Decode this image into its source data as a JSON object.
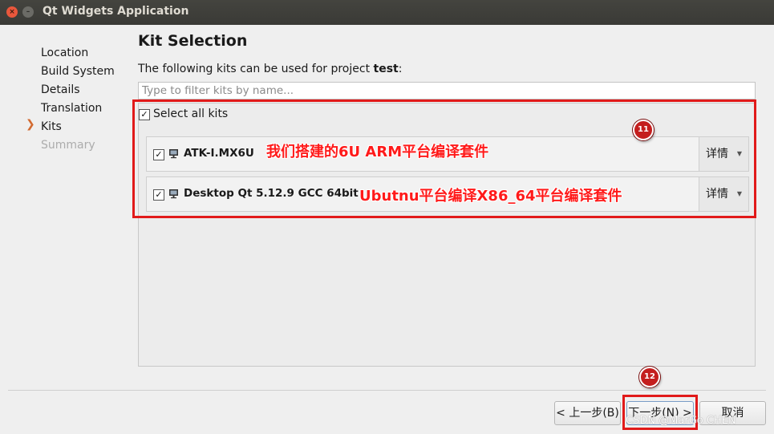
{
  "window": {
    "title": "Qt Widgets Application",
    "close_glyph": "×",
    "minimize_glyph": "–"
  },
  "sidebar": {
    "items": [
      {
        "label": "Location",
        "state": "done"
      },
      {
        "label": "Build System",
        "state": "done"
      },
      {
        "label": "Details",
        "state": "done"
      },
      {
        "label": "Translation",
        "state": "done"
      },
      {
        "label": "Kits",
        "state": "current"
      },
      {
        "label": "Summary",
        "state": "disabled"
      }
    ],
    "current_marker": "❯"
  },
  "main": {
    "title": "Kit Selection",
    "description_prefix": "The following kits can be used for project ",
    "project_name": "test",
    "description_suffix": ":",
    "filter": {
      "value": "",
      "placeholder": "Type to filter kits by name..."
    },
    "select_all": {
      "label": "Select all kits",
      "checked": true,
      "check_glyph": "✓"
    },
    "kits": [
      {
        "name": "ATK-I.MX6U",
        "checked": true,
        "details_label": "详情",
        "icon": "monitor-icon"
      },
      {
        "name": "Desktop Qt 5.12.9 GCC 64bit",
        "checked": true,
        "details_label": "详情",
        "icon": "monitor-icon"
      }
    ],
    "details_caret": "▼"
  },
  "annotations": {
    "kit1_note": "我们搭建的6U ARM平台编译套件",
    "kit2_note": "Ubutnu平台编译X86_64平台编译套件",
    "badge_kits": "11",
    "badge_next": "12",
    "color": "#e11a1a"
  },
  "footer": {
    "back_label": "< 上一步(B)",
    "next_label": "下一步(N) >",
    "cancel_label": "取消"
  },
  "watermark": "CSDN @MarGo CHEN",
  "colors": {
    "titlebar": "#3c3b37",
    "accent_arrow": "#d26a30",
    "background": "#efefef"
  }
}
